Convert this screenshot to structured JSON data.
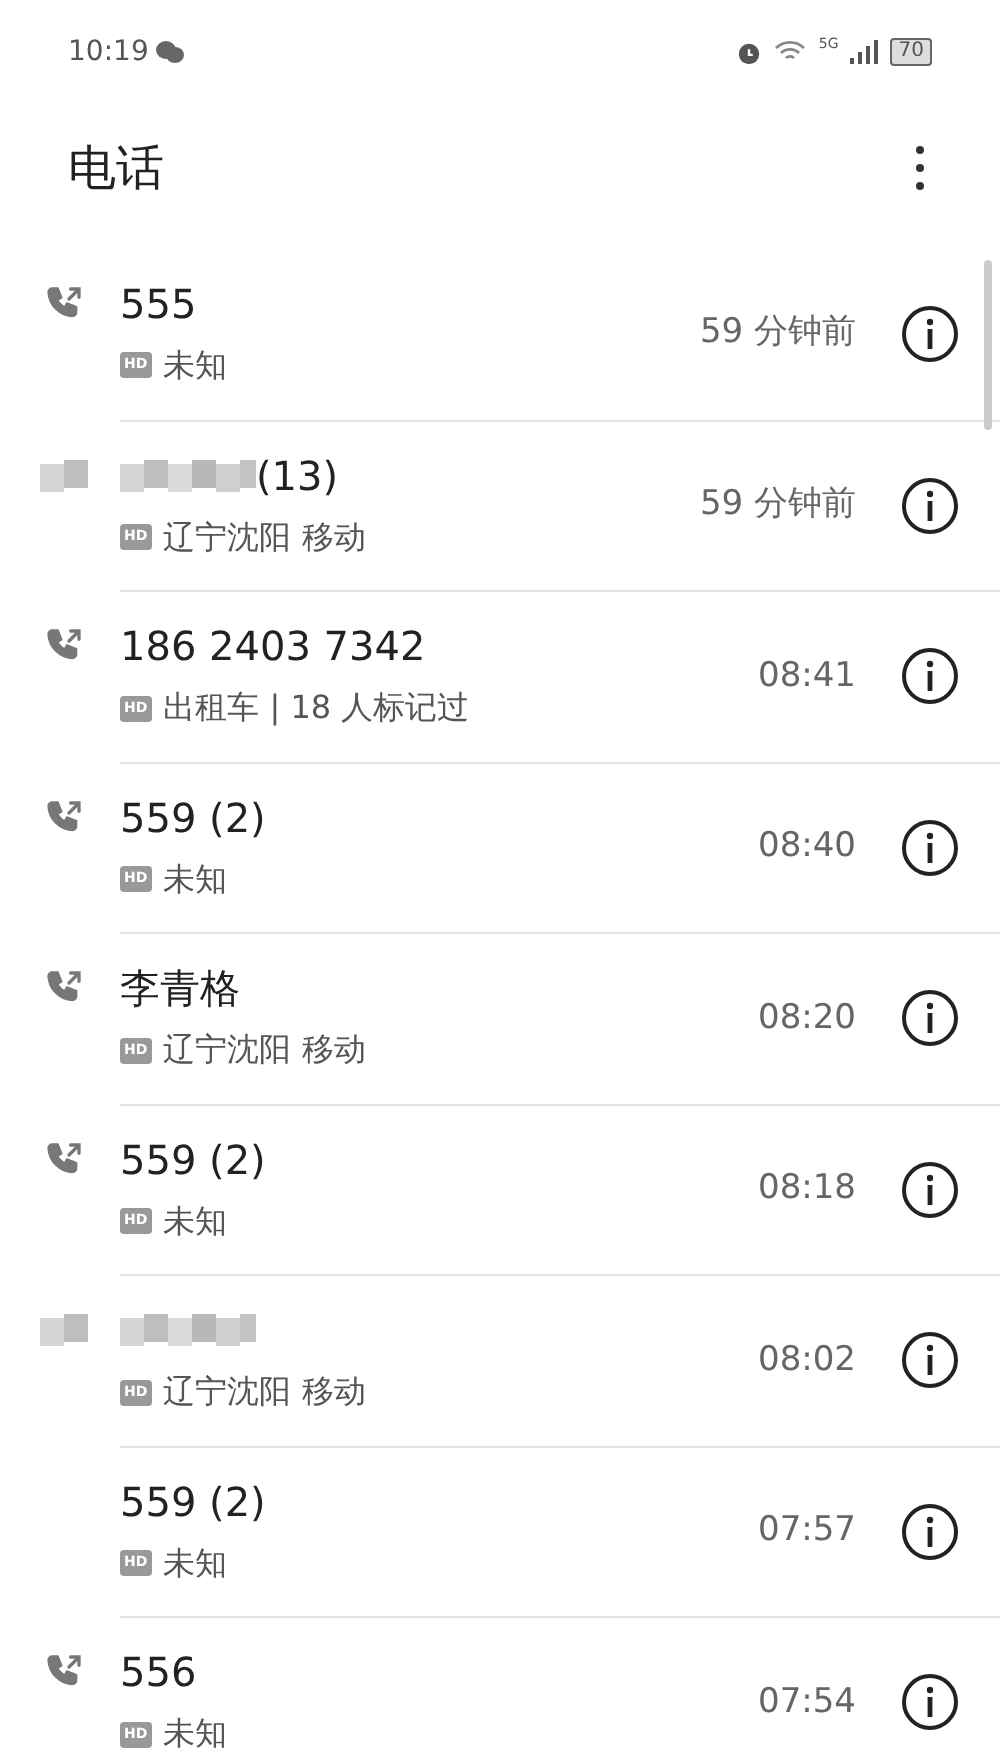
{
  "status_bar": {
    "time": "10:19",
    "network": "5G",
    "battery": "70"
  },
  "header": {
    "title": "电话"
  },
  "calls": [
    {
      "kind": "outgoing",
      "redacted": false,
      "name": "555",
      "hd": "HD",
      "detail": "未知",
      "time": "59 分钟前"
    },
    {
      "kind": "redacted",
      "redacted": true,
      "name": "(13)",
      "hd": "HD",
      "detail": "辽宁沈阳 移动",
      "time": "59 分钟前"
    },
    {
      "kind": "outgoing",
      "redacted": false,
      "name": "186 2403 7342",
      "hd": "HD",
      "detail": "出租车 | 18 人标记过",
      "time": "08:41"
    },
    {
      "kind": "outgoing",
      "redacted": false,
      "name": "559 (2)",
      "hd": "HD",
      "detail": "未知",
      "time": "08:40"
    },
    {
      "kind": "outgoing",
      "redacted": false,
      "name": "李青格",
      "hd": "HD",
      "detail": "辽宁沈阳 移动",
      "time": "08:20"
    },
    {
      "kind": "outgoing",
      "redacted": false,
      "name": "559 (2)",
      "hd": "HD",
      "detail": "未知",
      "time": "08:18"
    },
    {
      "kind": "redacted",
      "redacted": true,
      "hd": "HD",
      "detail": "辽宁沈阳 移动",
      "time": "08:02"
    },
    {
      "kind": "none",
      "redacted": false,
      "name": "559 (2)",
      "hd": "HD",
      "detail": "未知",
      "time": "07:57"
    },
    {
      "kind": "outgoing",
      "redacted": false,
      "name": "556",
      "hd": "HD",
      "detail": "未知",
      "time": "07:54"
    }
  ]
}
